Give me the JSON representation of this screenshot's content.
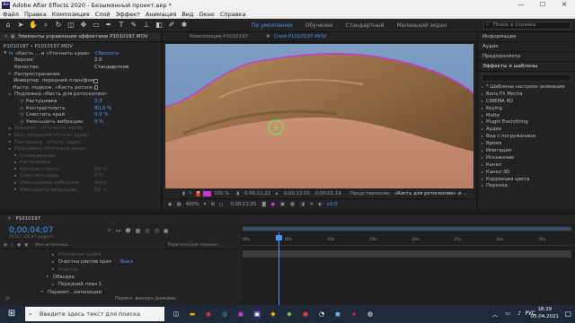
{
  "window": {
    "title": "Adobe After Effects 2020 - Безымянный проект.aep *",
    "app_badge": "Ae",
    "min": "—",
    "max": "☐",
    "close": "✕"
  },
  "menu": [
    "Файл",
    "Правка",
    "Композиция",
    "Слой",
    "Эффект",
    "Анимация",
    "Вид",
    "Окно",
    "Справка"
  ],
  "workspaces": [
    "По умолчанию",
    "Обучение",
    "Стандартный",
    "Маленький экран"
  ],
  "search_help": "Поиск в справке",
  "effects_panel": {
    "tab": "Элементы управления эффектами P1010197.MOV",
    "layer": "P1010197 • P1010197.MOV",
    "effect_name": "«Кисть ... и «Уточнить края»",
    "reset": "Сбросить",
    "rows": [
      {
        "label": "Версия",
        "value": "2.0",
        "indent": 1,
        "kind": "text"
      },
      {
        "label": "Качество",
        "value": "Стандартное",
        "indent": 1,
        "kind": "select"
      },
      {
        "label": "Распространение",
        "value": "",
        "indent": 1,
        "kind": "group"
      },
      {
        "label": "Инвертир. передний план/фон",
        "value": "",
        "indent": 1,
        "kind": "check"
      },
      {
        "label": "Настр. подкож. «Кисть ротоск.",
        "value": "",
        "indent": 1,
        "kind": "check"
      },
      {
        "label": "Подложка «Кисть для ротоскопии»",
        "value": "",
        "indent": 1,
        "kind": "group"
      },
      {
        "label": "Растушевка",
        "value": "0,0",
        "indent": 2,
        "kind": "num"
      },
      {
        "label": "Контрастность",
        "value": "80,0 %",
        "indent": 2,
        "kind": "num"
      },
      {
        "label": "Сместить край",
        "value": "0,0 %",
        "indent": 2,
        "kind": "num"
      },
      {
        "label": "Уменьшить вибрацию",
        "value": "0 %",
        "indent": 2,
        "kind": "num"
      },
      {
        "label": "Уведомл. «Уточнить край»",
        "value": "",
        "indent": 1,
        "kind": "dim"
      },
      {
        "label": "Исп. сведения «Уточн. края»",
        "value": "",
        "indent": 1,
        "kind": "dim"
      },
      {
        "label": "Тип налож. «Уточн. края»",
        "value": "",
        "indent": 1,
        "kind": "dim"
      },
      {
        "label": "Подложка «Уточнить края»",
        "value": "",
        "indent": 1,
        "kind": "dim"
      },
      {
        "label": "Сглаживание",
        "value": "",
        "indent": 2,
        "kind": "dim"
      },
      {
        "label": "Растушевка",
        "value": "",
        "indent": 2,
        "kind": "dim"
      },
      {
        "label": "Контрастность",
        "value": "50 %",
        "indent": 2,
        "kind": "dim"
      },
      {
        "label": "Сместить край",
        "value": "0 %",
        "indent": 2,
        "kind": "dim"
      },
      {
        "label": "Уменьшение вибрации",
        "value": "Авто",
        "indent": 2,
        "kind": "dim"
      },
      {
        "label": "Уменьшить вибрацию",
        "value": "50 %",
        "indent": 2,
        "kind": "dim"
      }
    ]
  },
  "viewer": {
    "tabs": [
      {
        "label": "Композиция P1010197",
        "active": false
      },
      {
        "label": "Слой P1010197.MOV",
        "active": true
      }
    ],
    "ruler_ticks": [
      "00k",
      "05k",
      "10k",
      "15k",
      "20k",
      "25k",
      "30k",
      "35k"
    ],
    "ctrl1": {
      "zoom": "100 %",
      "t1": "0;00;11;22",
      "t2": "0;00;13;10",
      "t3": "0;00;01;19",
      "view_label": "Представление:",
      "view_value": "«Кисть для ротоскопии» и ..."
    },
    "ctrl2": {
      "magnify": "400%",
      "time": "0;00;11;25",
      "offset": "+0,0"
    }
  },
  "right_panel": {
    "sections": [
      "Информация",
      "Аудио",
      "Предпросмотр"
    ],
    "effects_title": "Эффекты и шаблоны",
    "items": [
      "* Шаблоны настроек анимации",
      "Boris FX Mocha",
      "CINEMA 4D",
      "Keying",
      "Matte",
      "Plugin Everything",
      "Аудио",
      "Вид с погружением",
      "Время",
      "Имитация",
      "Искажение",
      "Канал",
      "Канал 3D",
      "Коррекция цвета",
      "Переход"
    ]
  },
  "timeline": {
    "tab": "P1010197",
    "timecode": "0;00;04;07",
    "timecode_sub": "00127 (29,97 кадр/с)",
    "col_name": "Имя источника",
    "col_parent": "Родительский элемент...",
    "rows": [
      {
        "label": "Уточнение краёв",
        "value": "",
        "dim": true,
        "indent": 3
      },
      {
        "label": "Очистка цветов края",
        "value": "Выкл",
        "dim": false,
        "indent": 3
      },
      {
        "label": "Участок",
        "value": "",
        "dim": true,
        "indent": 3
      },
      {
        "label": "Обводки",
        "value": "",
        "dim": false,
        "indent": 2
      },
      {
        "label": "Передний план 1",
        "value": "",
        "dim": false,
        "indent": 3
      },
      {
        "label": "Парамет...омпозиции",
        "value": "",
        "dim": false,
        "indent": 1
      }
    ],
    "ruler": [
      "00s",
      "05s",
      "10s",
      "15s",
      "20s",
      "25s",
      "30s",
      "35s"
    ],
    "footer": "Перекл. выключ./режимы"
  },
  "taskbar": {
    "search": "Введите здесь текст для поиска",
    "time": "18:39",
    "date": "05.04.2021",
    "lang": "РУС"
  }
}
